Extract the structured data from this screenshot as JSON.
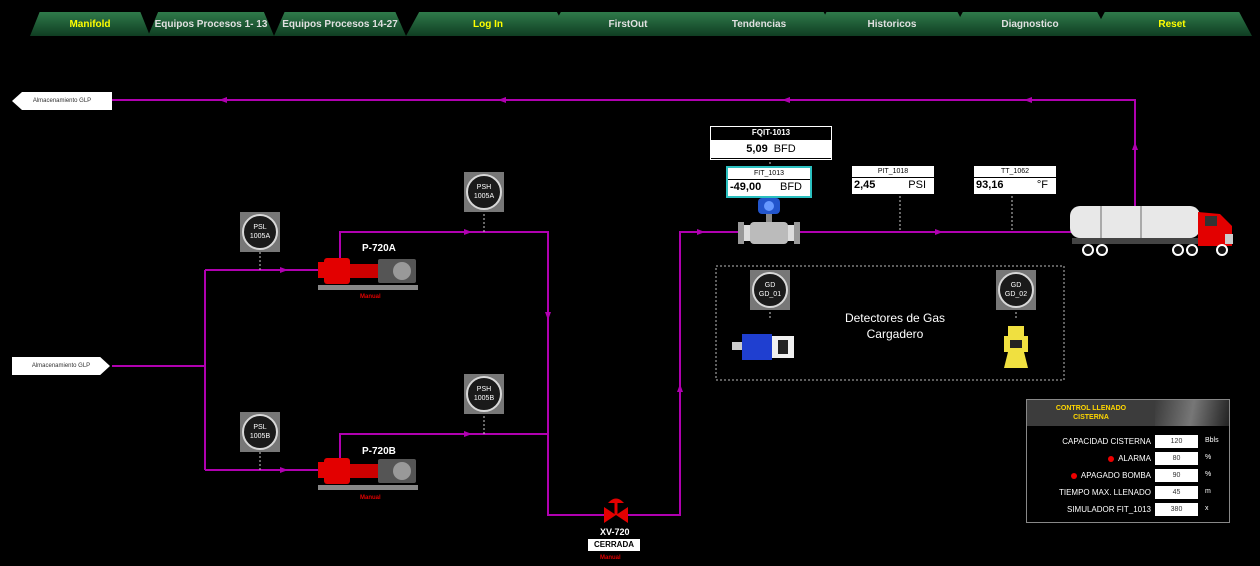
{
  "tabs": [
    "Manifold",
    "Equipos Procesos  1- 13",
    "Equipos Procesos 14-27",
    "Log In",
    "FirstOut",
    "Tendencias",
    "Historicos",
    "Diagnostico",
    "Reset"
  ],
  "storage": {
    "top_label": "Almacenamiento GLP",
    "left_label": "Almacenamiento GLP"
  },
  "pumps": {
    "a": {
      "name": "P-720A",
      "mode": "Manual"
    },
    "b": {
      "name": "P-720B",
      "mode": "Manual"
    }
  },
  "instruments": {
    "psl_a": [
      "PSL",
      "1005A"
    ],
    "psl_b": [
      "PSL",
      "1005B"
    ],
    "psh_a": [
      "PSH",
      "1005A"
    ],
    "psh_b": [
      "PSH",
      "1005B"
    ],
    "gd_01": [
      "GD",
      "GD_01"
    ],
    "gd_02": [
      "GD",
      "GD_02"
    ]
  },
  "fqit": {
    "tag": "FQIT-1013",
    "value": "5,09",
    "unit": "BFD"
  },
  "fit": {
    "tag": "FIT_1013",
    "value": "-49,00",
    "unit": "BFD"
  },
  "pit": {
    "tag": "PIT_1018",
    "value": "2,45",
    "unit": "PSI"
  },
  "tt": {
    "tag": "TT_1062",
    "value": "93,16",
    "unit": "°F"
  },
  "valve": {
    "tag": "XV-720",
    "state": "CERRADA",
    "mode": "Manual"
  },
  "gas": {
    "line1": "Detectores de Gas",
    "line2": "Cargadero"
  },
  "control": {
    "title_line1": "CONTROL LLENADO",
    "title_line2": "CISTERNA",
    "rows": [
      {
        "label": "CAPACIDAD CISTERNA",
        "value": "120",
        "unit": "Bbls",
        "dot": false
      },
      {
        "label": "ALARMA",
        "value": "80",
        "unit": "%",
        "dot": true
      },
      {
        "label": "APAGADO BOMBA",
        "value": "90",
        "unit": "%",
        "dot": true
      },
      {
        "label": "TIEMPO MAX. LLENADO",
        "value": "45",
        "unit": "m",
        "dot": false
      },
      {
        "label": "SIMULADOR FIT_1013",
        "value": "380",
        "unit": "x",
        "dot": false
      }
    ]
  },
  "colors": {
    "pipe": "#b000b0",
    "tab_text": "#e0e0e0",
    "highlight": "#ffff00",
    "alarm": "#e00000"
  }
}
